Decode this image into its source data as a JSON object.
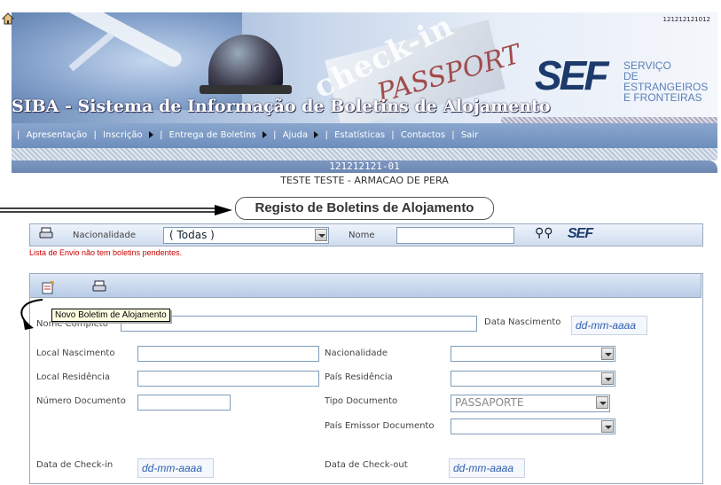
{
  "banner": {
    "app_title": "SIBA - Sistema de Informação de Boletins de Alojamento",
    "checkin_text": "check-in",
    "passport_text": "PASSPORT",
    "sef_logo": "SEF",
    "sef_name_1": "SERVIÇO",
    "sef_name_2": "DE ESTRANGEIROS",
    "sef_name_3": "E FRONTEIRAS",
    "id_small": "121212121012"
  },
  "menu": {
    "items": [
      "Apresentação",
      "Inscrição",
      "Entrega de Boletins",
      "Ajuda",
      "Estatísticas",
      "Contactos",
      "Sair"
    ]
  },
  "user": {
    "id": "121212121-01",
    "establishment": "TESTE TESTE - ARMACAO DE PERA"
  },
  "page_title": "Registo de Boletins de Alojamento",
  "filter": {
    "nationality_label": "Nacionalidade",
    "nationality_value": "( Todas )",
    "name_label": "Nome",
    "name_value": "",
    "sef_small": "SEF"
  },
  "error_message": "Lista de Envio não tem boletins pendentes.",
  "tooltip": "Novo Boletim de Alojamento",
  "form": {
    "nome_completo": "Nome Completo",
    "data_nascimento": "Data Nascimento",
    "local_nascimento": "Local Nascimento",
    "nacionalidade": "Nacionalidade",
    "local_residencia": "Local Residência",
    "pais_residencia": "País Residência",
    "numero_documento": "Número Documento",
    "tipo_documento": "Tipo Documento",
    "tipo_documento_value": "PASSAPORTE",
    "pais_emissor": "País Emissor Documento",
    "data_checkin": "Data de Check-in",
    "data_checkout": "Data de Check-out",
    "date_placeholder": "dd-mm-aaaa"
  }
}
